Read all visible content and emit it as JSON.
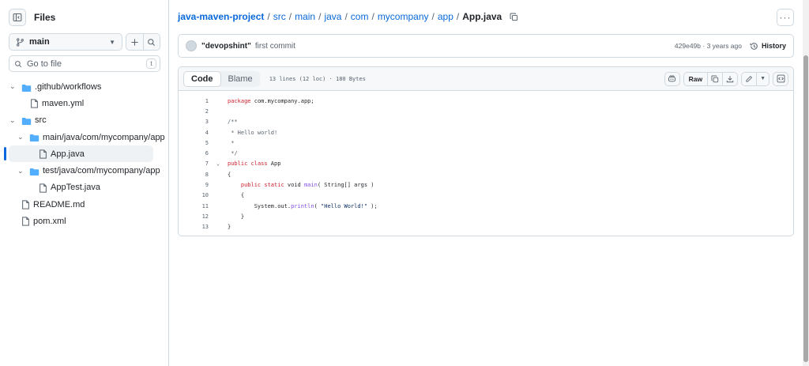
{
  "sidebar": {
    "title": "Files",
    "branch": "main",
    "goto_placeholder": "Go to file",
    "goto_shortcut": "t",
    "tree": [
      {
        "label": ".github/workflows",
        "type": "folder",
        "depth": 0,
        "expanded": true
      },
      {
        "label": "maven.yml",
        "type": "file",
        "depth": 1
      },
      {
        "label": "src",
        "type": "folder",
        "depth": 0,
        "expanded": true
      },
      {
        "label": "main/java/com/mycompany/app",
        "type": "folder",
        "depth": 1,
        "expanded": true
      },
      {
        "label": "App.java",
        "type": "file",
        "depth": 2,
        "selected": true
      },
      {
        "label": "test/java/com/mycompany/app",
        "type": "folder",
        "depth": 1,
        "expanded": true
      },
      {
        "label": "AppTest.java",
        "type": "file",
        "depth": 2
      },
      {
        "label": "README.md",
        "type": "file",
        "depth": 0
      },
      {
        "label": "pom.xml",
        "type": "file",
        "depth": 0
      }
    ]
  },
  "breadcrumb": {
    "repo": "java-maven-project",
    "parts": [
      "src",
      "main",
      "java",
      "com",
      "mycompany",
      "app"
    ],
    "current": "App.java"
  },
  "commit": {
    "author": "\"devopshint\"",
    "message": "first commit",
    "sha_time": "429e49b · 3 years ago",
    "history_label": "History"
  },
  "file": {
    "tabs": [
      "Code",
      "Blame"
    ],
    "active_tab": "Code",
    "meta": "13 lines (12 loc) · 180 Bytes",
    "raw_label": "Raw",
    "lines": [
      [
        {
          "t": "package",
          "c": "kw"
        },
        {
          "t": " com.mycompany.app;",
          "c": "tx"
        }
      ],
      [],
      [
        {
          "t": "/**",
          "c": "cm"
        }
      ],
      [
        {
          "t": " * Hello world!",
          "c": "cm"
        }
      ],
      [
        {
          "t": " *",
          "c": "cm"
        }
      ],
      [
        {
          "t": " */",
          "c": "cm"
        }
      ],
      [
        {
          "t": "public",
          "c": "kw"
        },
        {
          "t": " ",
          "c": "tx"
        },
        {
          "t": "class",
          "c": "kw"
        },
        {
          "t": " App",
          "c": "tx"
        }
      ],
      [
        {
          "t": "{",
          "c": "tx"
        }
      ],
      [
        {
          "t": "    ",
          "c": "tx"
        },
        {
          "t": "public",
          "c": "kw"
        },
        {
          "t": " ",
          "c": "tx"
        },
        {
          "t": "static",
          "c": "kw"
        },
        {
          "t": " void ",
          "c": "tx"
        },
        {
          "t": "main",
          "c": "fn"
        },
        {
          "t": "( String[] args )",
          "c": "tx"
        }
      ],
      [
        {
          "t": "    {",
          "c": "tx"
        }
      ],
      [
        {
          "t": "        System.out.",
          "c": "tx"
        },
        {
          "t": "println",
          "c": "fn"
        },
        {
          "t": "( ",
          "c": "tx"
        },
        {
          "t": "\"Hello World!\"",
          "c": "str"
        },
        {
          "t": " );",
          "c": "tx"
        }
      ],
      [
        {
          "t": "    }",
          "c": "tx"
        }
      ],
      [
        {
          "t": "}",
          "c": "tx"
        }
      ]
    ],
    "fold_line": 7
  },
  "colors": {
    "link": "#0969da",
    "keyword": "#cf222e",
    "function": "#8250df",
    "string": "#0a3069",
    "folder": "#54aeff"
  }
}
